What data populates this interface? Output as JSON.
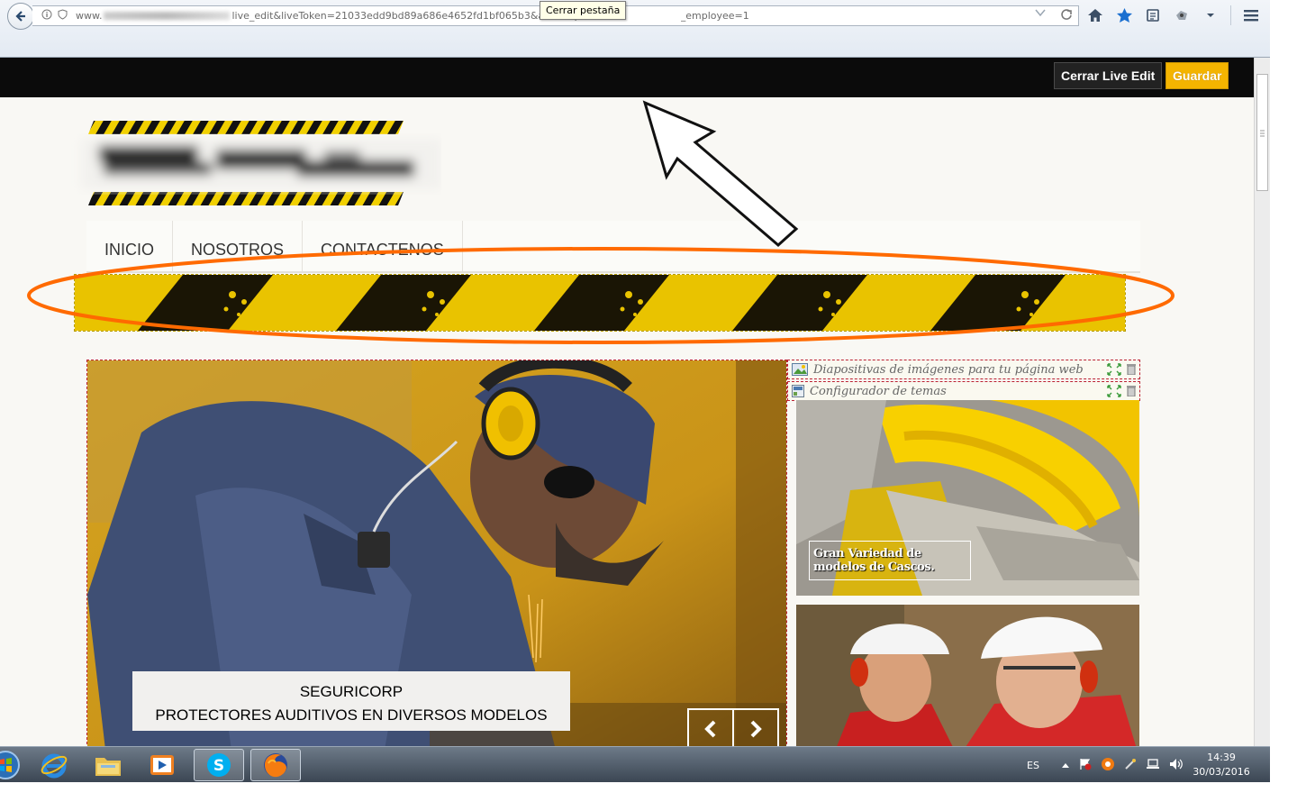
{
  "browser": {
    "url_prefix": "www.",
    "url_text": "live_edit&liveToken=21033edd9bd89a686e4652fd1bf065b3&ad=carpet",
    "url_tail": "_employee=1",
    "tooltip": "Cerrar pestaña",
    "icons": [
      "back-arrow-icon",
      "info-icon",
      "shield-icon",
      "dropdown-icon",
      "reload-icon",
      "home-icon",
      "bookmark-star-icon",
      "reading-list-icon",
      "extension-icon",
      "menu-icon"
    ]
  },
  "live_edit": {
    "close_label": "Cerrar Live Edit",
    "save_label": "Guardar"
  },
  "menu": {
    "items": [
      "INICIO",
      "NOSOTROS",
      "CONTACTENOS"
    ]
  },
  "hero": {
    "caption_line1": "SEGURICORP",
    "caption_line2": "PROTECTORES AUDITIVOS EN DIVERSOS MODELOS"
  },
  "modules": {
    "slides_label": "Diapositivas de imágenes para tu página web",
    "theme_label": "Configurador de temas"
  },
  "side": {
    "caption": "Gran Variedad de modelos de Cascos."
  },
  "taskbar": {
    "apps": [
      "windows-start-icon",
      "internet-explorer-icon",
      "file-explorer-icon",
      "media-player-icon",
      "skype-icon",
      "firefox-icon"
    ],
    "lang": "ES",
    "time": "14:39",
    "date": "30/03/2016"
  },
  "colors": {
    "accent_yellow": "#f4b400",
    "highlight_orange": "#ff6a00",
    "live_bar": "#0b0b0b"
  }
}
